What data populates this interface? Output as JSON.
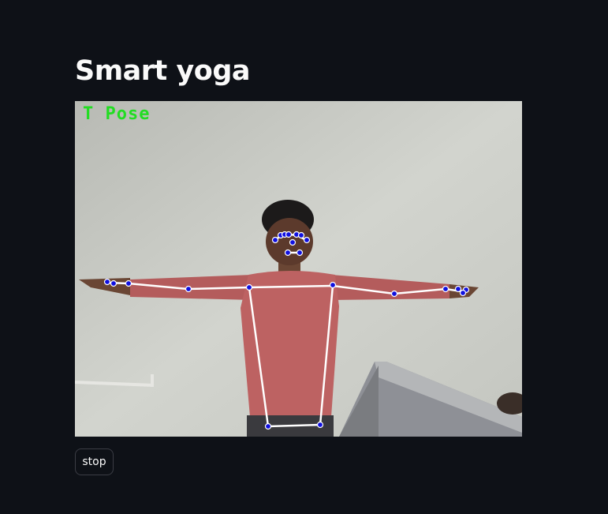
{
  "page": {
    "title": "Smart yoga"
  },
  "video": {
    "pose_label": "T Pose"
  },
  "controls": {
    "stop_label": "stop"
  },
  "colors": {
    "background": "#0e1117",
    "pose_label": "#22dd22",
    "skeleton_line": "#ffffff",
    "keypoint": "#1010e0"
  }
}
